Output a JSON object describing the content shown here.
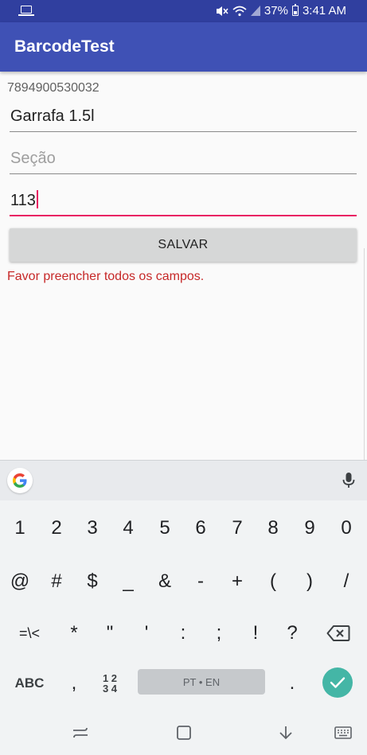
{
  "status_bar": {
    "battery_percent": "37%",
    "time": "3:41 AM"
  },
  "app_bar": {
    "title": "BarcodeTest"
  },
  "form": {
    "barcode_value": "7894900530032",
    "product_field": {
      "value": "Garrafa 1.5l"
    },
    "section_field": {
      "value": "",
      "placeholder": "Seção"
    },
    "quantity_field": {
      "value": "113"
    },
    "save_button_label": "SALVAR",
    "error_message": "Favor preencher todos os campos."
  },
  "keyboard": {
    "row_numbers": [
      "1",
      "2",
      "3",
      "4",
      "5",
      "6",
      "7",
      "8",
      "9",
      "0"
    ],
    "row_symbols_1": [
      "@",
      "#",
      "$",
      "_",
      "&",
      "-",
      "+",
      "(",
      ")",
      "/"
    ],
    "row_symbols_2": [
      "=\\<",
      "*",
      "\"",
      "'",
      ":",
      ";",
      "!",
      "?"
    ],
    "abc_label": "ABC",
    "comma_label": ",",
    "fraction_top": "1 2",
    "fraction_bottom": "3 4",
    "space_label": "PT • EN",
    "period_label": "."
  },
  "colors": {
    "status_bar": "#303f9f",
    "app_bar": "#3f51b5",
    "accent": "#e91e63",
    "error": "#c62828",
    "enter_key": "#44b6a6"
  }
}
